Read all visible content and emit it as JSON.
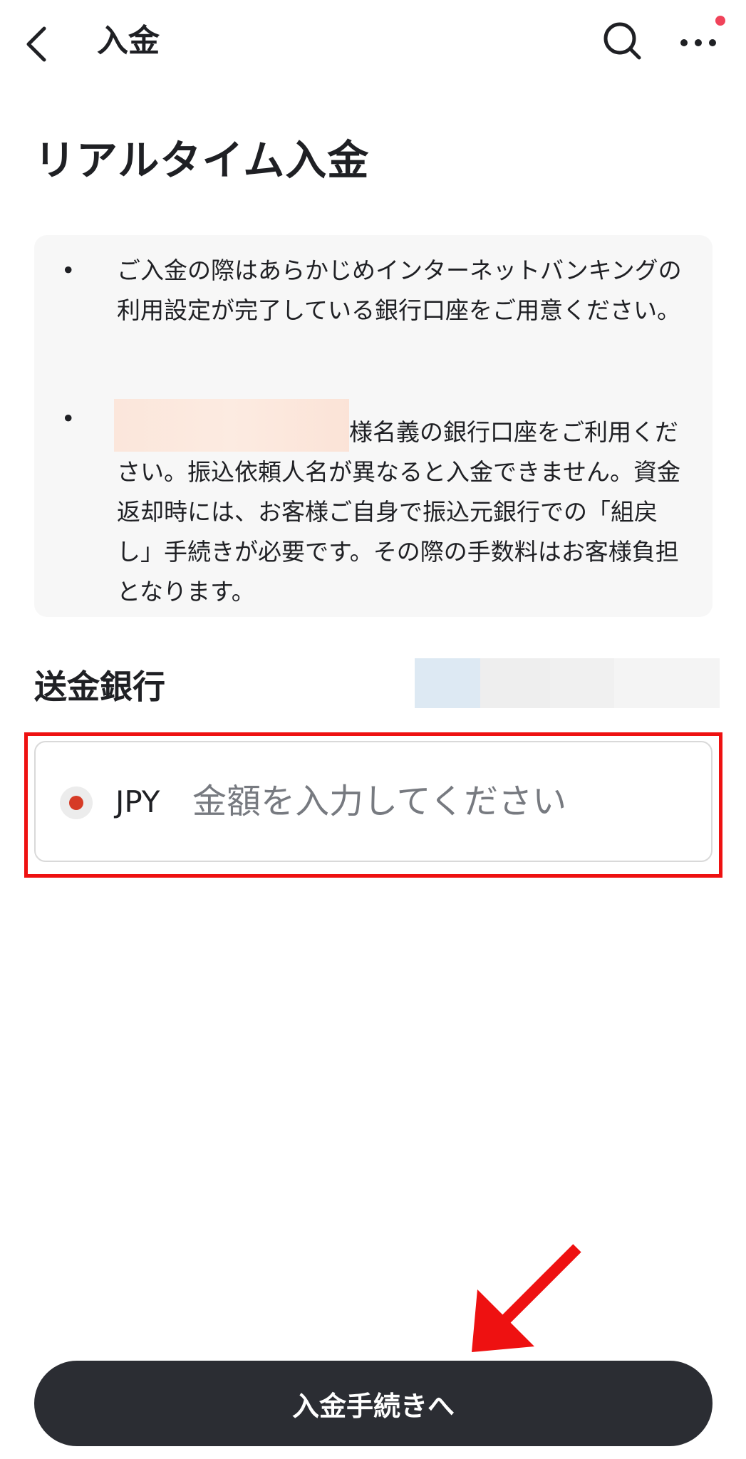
{
  "header": {
    "back_icon": "chevron-left-icon",
    "title": "入金",
    "search_icon": "search-icon",
    "more_icon": "more-horizontal-icon",
    "notification_dot_color": "#f0435a"
  },
  "page": {
    "title": "リアルタイム入金"
  },
  "notice": {
    "bullet_symbol": "•",
    "items": [
      {
        "text": "ご入金の際はあらかじめインターネットバンキングの利用設定が完了している銀行口座をご用意ください。"
      },
      {
        "text": "様名義の銀行口座をご利用ください。振込依頼人名が異なると入金できません。資金返却時には、お客様ご自身で振込元銀行での「組戻し」手続きが必要です。その際の手数料はお客様負担となります。"
      }
    ]
  },
  "section": {
    "label": "送金銀行"
  },
  "amount": {
    "currency_code": "JPY",
    "currency_icon": "jpy-flag-icon",
    "value": "",
    "placeholder": "金額を入力してください"
  },
  "primary_button": {
    "label": "入金手続きへ",
    "color": "#2b2d33"
  },
  "annotations": {
    "highlight_color": "#ee1111",
    "arrow_icon": "red-arrow-icon"
  }
}
